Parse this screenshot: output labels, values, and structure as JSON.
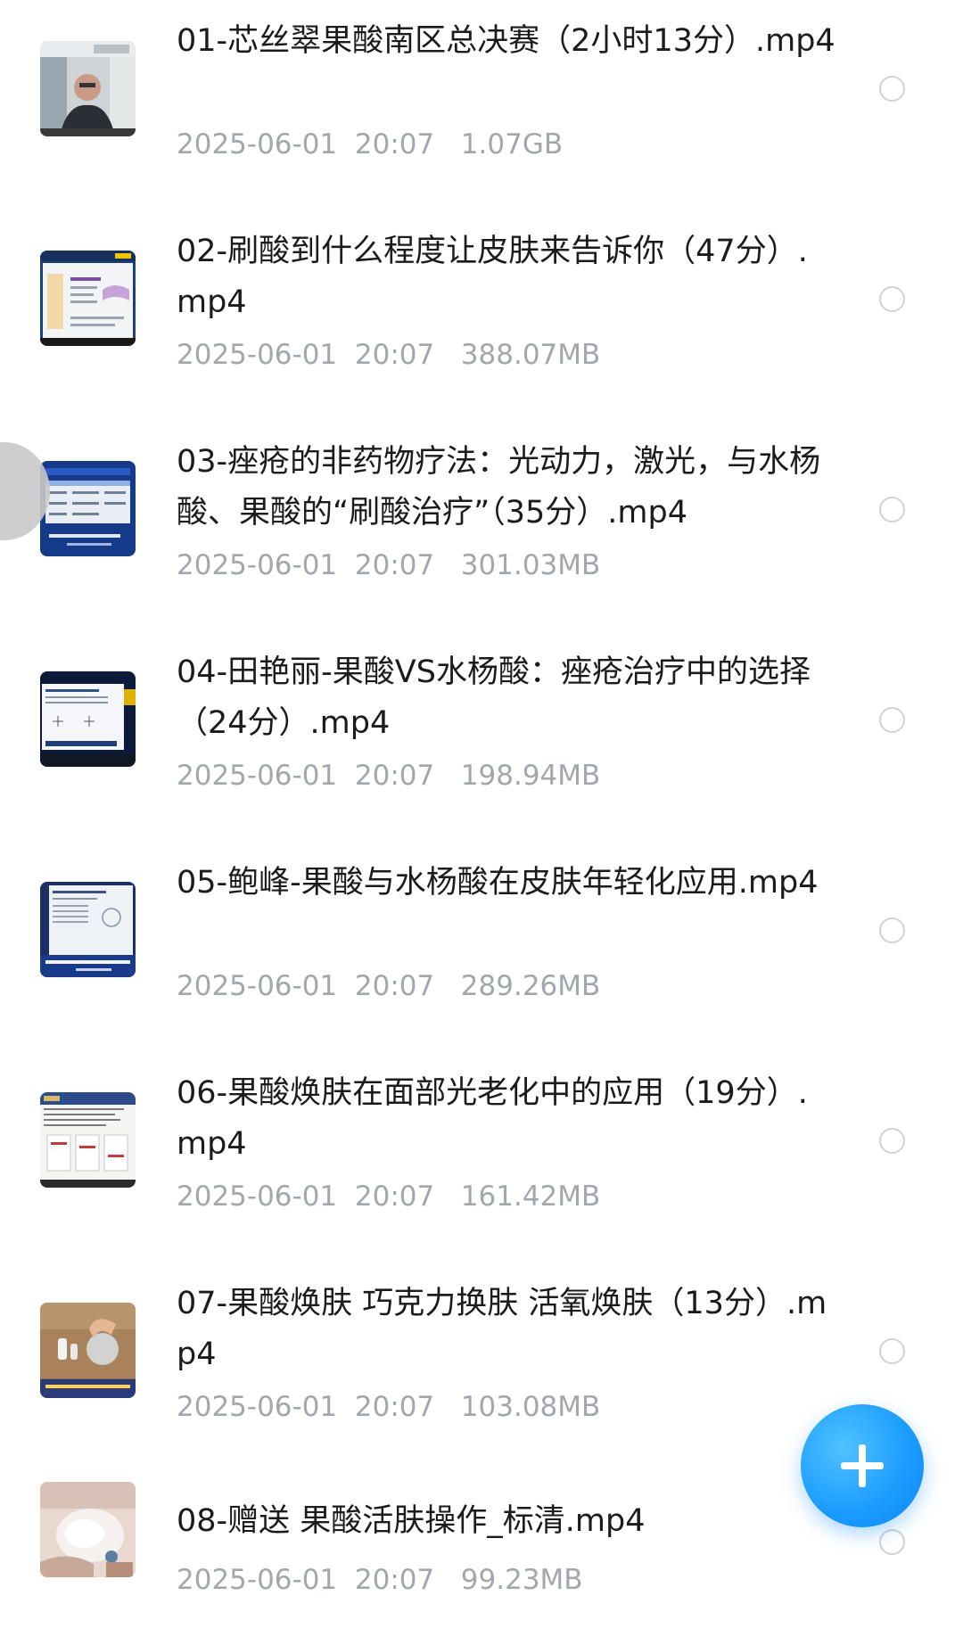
{
  "files": [
    {
      "name": "01-芯丝翠果酸南区总决赛（2小时13分）.mp4",
      "date": "2025-06-01",
      "time": "20:07",
      "size": "1.07GB",
      "thumb": "video-thumbnail-man-speaking"
    },
    {
      "name": "02-刷酸到什么程度让皮肤来告诉你（47分）.mp4",
      "date": "2025-06-01",
      "time": "20:07",
      "size": "388.07MB",
      "thumb": "video-thumbnail-slide"
    },
    {
      "name": "03-痤疮的非药物疗法：光动力，激光，与水杨酸、果酸的“刷酸治疗”（35分）.mp4",
      "date": "2025-06-01",
      "time": "20:07",
      "size": "301.03MB",
      "thumb": "video-thumbnail-blue-slide"
    },
    {
      "name": "04-田艳丽-果酸VS水杨酸：痤疮治疗中的选择（24分）.mp4",
      "date": "2025-06-01",
      "time": "20:07",
      "size": "198.94MB",
      "thumb": "video-thumbnail-stage-slide"
    },
    {
      "name": "05-鲍峰-果酸与水杨酸在皮肤年轻化应用.mp4",
      "date": "2025-06-01",
      "time": "20:07",
      "size": "289.26MB",
      "thumb": "video-thumbnail-lecture-slide"
    },
    {
      "name": "06-果酸焕肤在面部光老化中的应用（19分）.mp4",
      "date": "2025-06-01",
      "time": "20:07",
      "size": "161.42MB",
      "thumb": "video-thumbnail-document-slide"
    },
    {
      "name": "07-果酸焕肤 巧克力换肤 活氧焕肤（13分）.mp4",
      "date": "2025-06-01",
      "time": "20:07",
      "size": "103.08MB",
      "thumb": "video-thumbnail-demonstration"
    },
    {
      "name": "08-赠送 果酸活肤操作_标清.mp4",
      "date": "2025-06-01",
      "time": "20:07",
      "size": "99.23MB",
      "thumb": "video-thumbnail-facial-treatment"
    }
  ],
  "fab": {
    "icon": "plus-icon",
    "color": "#1a9aff"
  },
  "colors": {
    "title": "#1b1b1b",
    "meta": "#a3a7ad",
    "radio": "#cfd2d6"
  }
}
